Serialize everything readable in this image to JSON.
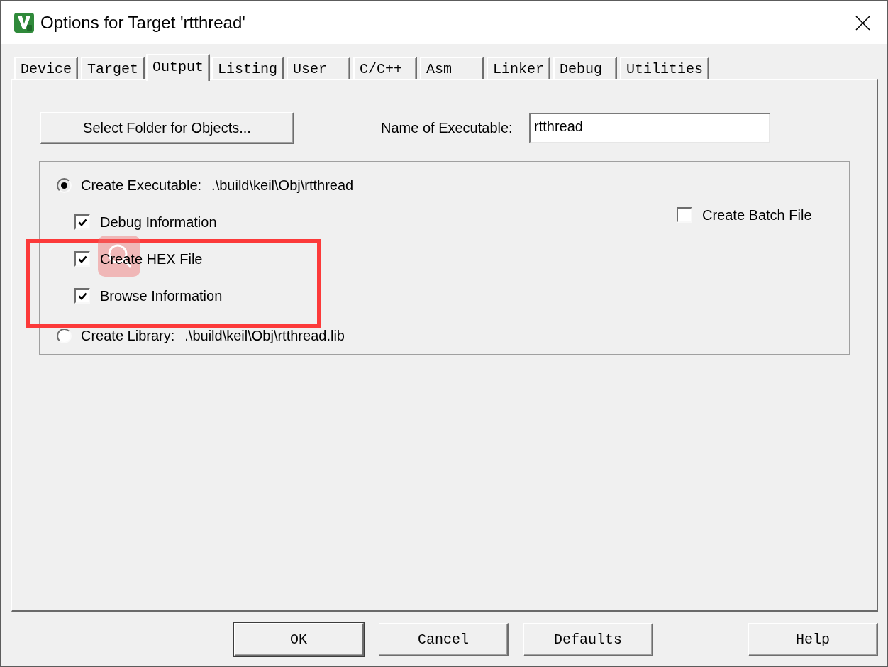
{
  "window": {
    "title": "Options for Target 'rtthread'"
  },
  "tabs": [
    {
      "label": "Device",
      "selected": false
    },
    {
      "label": "Target",
      "selected": false
    },
    {
      "label": "Output",
      "selected": true
    },
    {
      "label": "Listing",
      "selected": false
    },
    {
      "label": "User",
      "selected": false
    },
    {
      "label": "C/C++",
      "selected": false
    },
    {
      "label": "Asm",
      "selected": false
    },
    {
      "label": "Linker",
      "selected": false
    },
    {
      "label": "Debug",
      "selected": false
    },
    {
      "label": "Utilities",
      "selected": false
    }
  ],
  "output": {
    "select_folder_button": "Select Folder for Objects...",
    "executable_name": {
      "label": "Name of Executable:",
      "value": "rtthread"
    },
    "options": [
      {
        "kind": "radio",
        "label": "Create Executable:",
        "path": ".\\build\\keil\\Obj\\rtthread",
        "selected": true,
        "highlighted": false
      },
      {
        "kind": "checkbox",
        "label": "Debug Information",
        "checked": true,
        "highlighted": false
      },
      {
        "kind": "checkbox",
        "label": "Create HEX File",
        "checked": true,
        "highlighted": true
      },
      {
        "kind": "checkbox",
        "label": "Browse Information",
        "checked": true,
        "highlighted": true
      },
      {
        "kind": "radio",
        "label": "Create Library:",
        "path": ".\\build\\keil\\Obj\\rtthread.lib",
        "selected": false,
        "highlighted": false
      }
    ],
    "batch_file": {
      "label": "Create Batch File",
      "checked": false
    }
  },
  "buttons": [
    {
      "label": "OK",
      "default": true
    },
    {
      "label": "Cancel",
      "default": false
    },
    {
      "label": "Defaults",
      "default": false
    },
    {
      "label": "Help",
      "default": false
    }
  ]
}
